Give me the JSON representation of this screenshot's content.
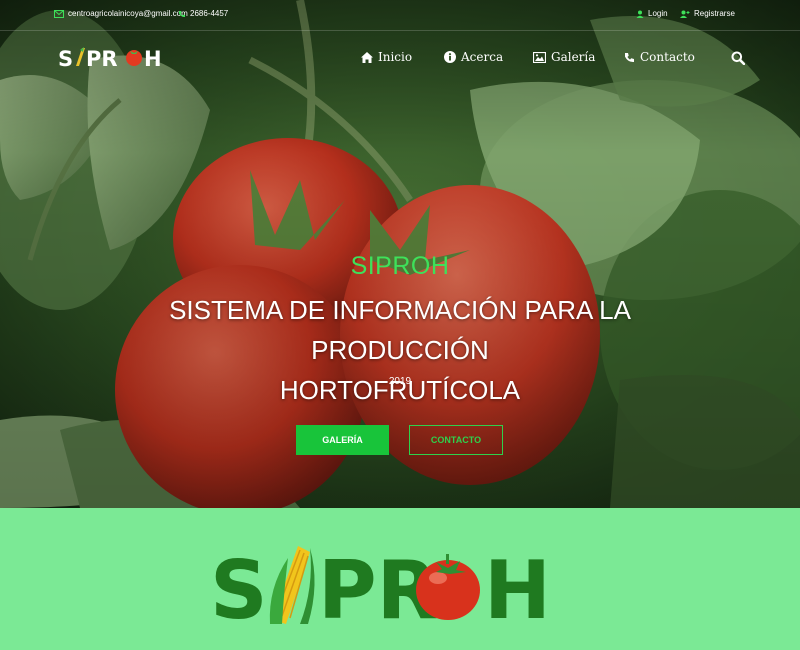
{
  "topbar": {
    "email": "centroagricolainicoya@gmail.com",
    "phone": "2686-4457",
    "login_label": "Login",
    "register_label": "Registrarse"
  },
  "brand": {
    "logo_letters": [
      "S",
      "PR",
      "H"
    ],
    "big_logo_letters": [
      "S",
      "PR",
      "H"
    ]
  },
  "nav": {
    "items": [
      {
        "label": "Inicio",
        "icon": "home-icon"
      },
      {
        "label": "Acerca",
        "icon": "info-icon"
      },
      {
        "label": "Galería",
        "icon": "image-icon"
      },
      {
        "label": "Contacto",
        "icon": "phone-icon"
      }
    ],
    "search_icon": "search-icon"
  },
  "hero": {
    "brand": "SIPROH",
    "title_line1": "SISTEMA DE INFORMACIÓN PARA LA PRODUCCIÓN",
    "title_line2": "HORTOFRUTÍCOLA",
    "year": "2019",
    "btn_primary": "GALERÍA",
    "btn_secondary": "CONTACTO"
  },
  "colors": {
    "accent_green": "#18c43a",
    "light_green_band": "#7be995",
    "logo_dark_green": "#1f7a20",
    "tomato_red": "#d8321c"
  }
}
